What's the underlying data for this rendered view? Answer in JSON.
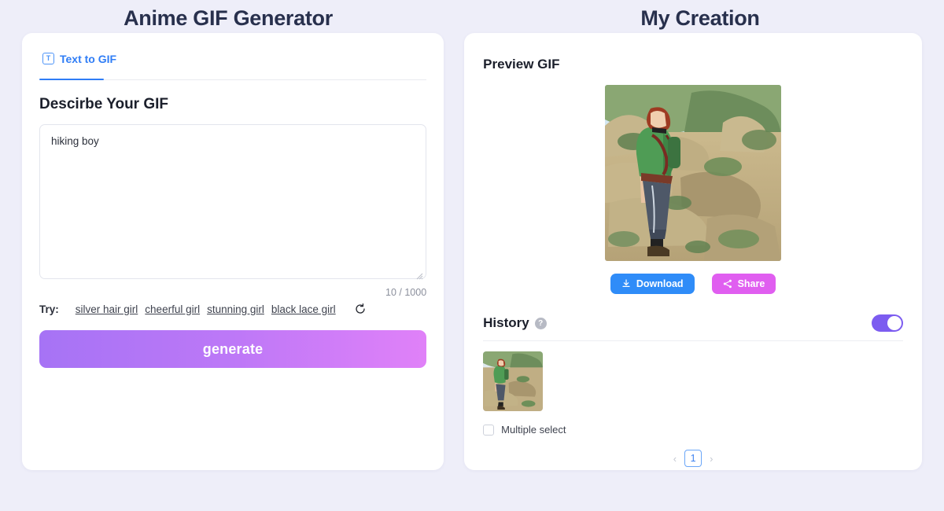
{
  "headers": {
    "left_title": "Anime GIF Generator",
    "right_title": "My Creation"
  },
  "generator": {
    "tab": {
      "label": "Text to GIF",
      "icon": "text-icon",
      "icon_glyph": "T"
    },
    "describe_heading": "Descirbe Your GIF",
    "prompt": {
      "value": "hiking boy",
      "placeholder": "Describe the GIF you want to create"
    },
    "char_count": "10 / 1000",
    "try": {
      "label": "Try:",
      "suggestions": [
        "silver hair girl",
        "cheerful girl",
        "stunning girl",
        "black lace girl"
      ],
      "refresh_icon": "refresh-icon"
    },
    "generate_label": "generate"
  },
  "creation": {
    "preview_heading": "Preview GIF",
    "preview_alt": "anime boy with red hair in green jacket hiking on rocky mountain terrain",
    "download_label": "Download",
    "download_icon": "download-icon",
    "share_label": "Share",
    "share_icon": "share-icon",
    "history": {
      "title": "History",
      "help_icon": "question-mark-icon",
      "help_glyph": "?",
      "toggle_state": "on",
      "items": [
        {
          "alt": "anime boy hiking thumbnail"
        }
      ],
      "multiple_select_label": "Multiple select",
      "multiple_select_checked": false,
      "pagination": {
        "prev": "‹",
        "next": "›",
        "current_page": "1"
      }
    }
  },
  "colors": {
    "background": "#eeeef9",
    "card": "#ffffff",
    "tab_blue": "#2f7df6",
    "generate_gradient_start": "#a673f5",
    "generate_gradient_end": "#e081f8",
    "download_blue": "#2f8cf8",
    "share_magenta": "#e05ef0",
    "toggle_purple": "#7c5cf0",
    "title_navy": "#28304d"
  }
}
